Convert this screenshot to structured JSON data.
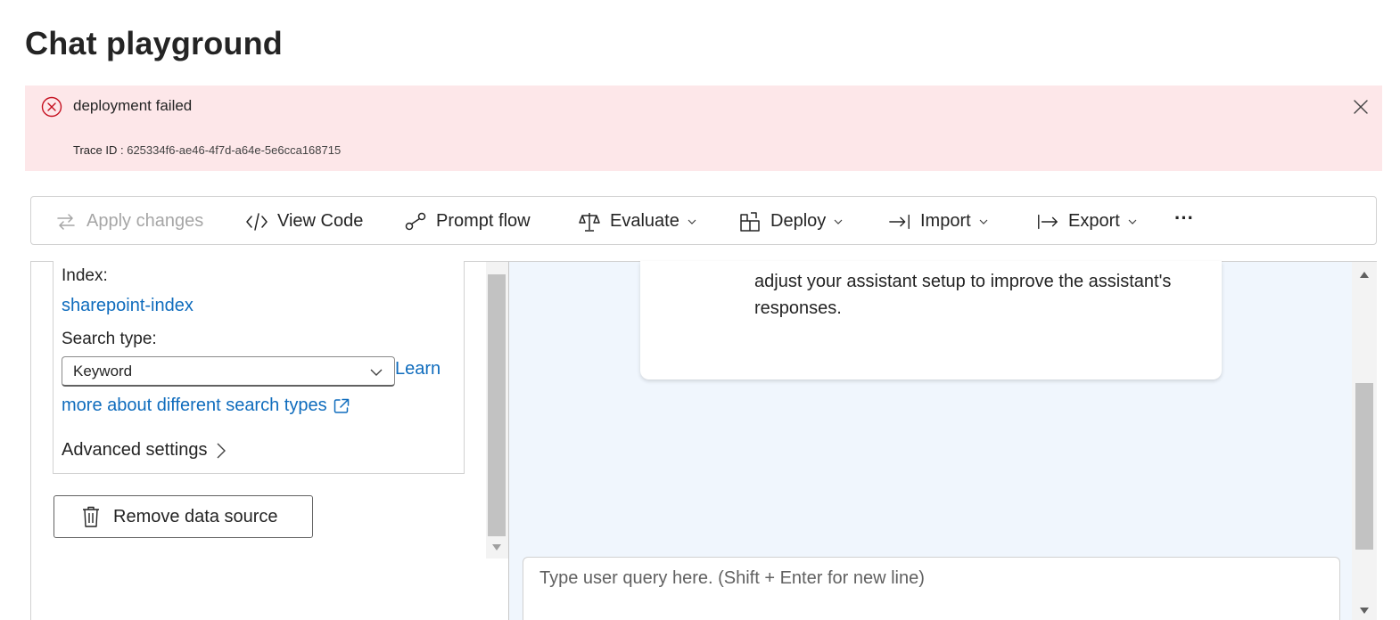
{
  "page": {
    "title": "Chat playground"
  },
  "error": {
    "message": "deployment failed",
    "trace_label": "Trace ID :",
    "trace_id": "625334f6-ae46-4f7d-a64e-5e6cca168715",
    "color": "#c50f1f",
    "background": "#fde7e9"
  },
  "toolbar": {
    "apply_label": "Apply changes",
    "view_code_label": "View Code",
    "prompt_flow_label": "Prompt flow",
    "evaluate_label": "Evaluate",
    "deploy_label": "Deploy",
    "import_label": "Import",
    "export_label": "Export",
    "more_label": "···"
  },
  "data_source": {
    "index_label": "Index:",
    "index_value": "sharepoint-index",
    "search_type_label": "Search type:",
    "search_type_value": "Keyword",
    "learn_link_part1": "Learn",
    "learn_link_part2": "more about different search types",
    "advanced_label": "Advanced settings",
    "remove_label": "Remove data source"
  },
  "chat": {
    "message_line1": "adjust your assistant setup to improve the assistant's",
    "message_line2": "responses.",
    "query_placeholder": "Type user query here. (Shift + Enter for new line)"
  },
  "colors": {
    "link": "#0f6cbd",
    "chat_background": "#f0f6fd"
  }
}
